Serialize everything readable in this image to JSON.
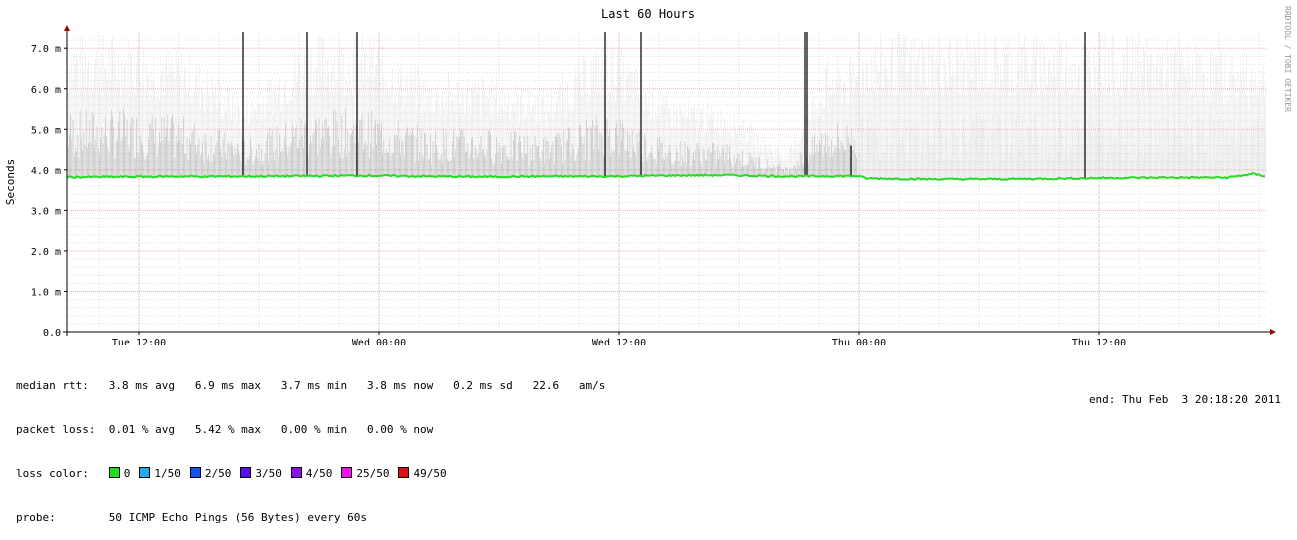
{
  "chart_data": {
    "type": "area",
    "title": "Last 60 Hours",
    "ylabel": "Seconds",
    "watermark": "RRDTOOL / TOBI OETIKER",
    "ylim": [
      0,
      7.4
    ],
    "y_ticks": [
      "0.0",
      "1.0 m",
      "2.0 m",
      "3.0 m",
      "4.0 m",
      "5.0 m",
      "6.0 m",
      "7.0 m"
    ],
    "y_tick_values": [
      0,
      1.0,
      2.0,
      3.0,
      4.0,
      5.0,
      6.0,
      7.0
    ],
    "x_range_hours": [
      0,
      60
    ],
    "x_ticks": [
      "Tue 12:00",
      "Wed 00:00",
      "Wed 12:00",
      "Thu 00:00",
      "Thu 12:00"
    ],
    "x_tick_hours": [
      3.6,
      15.6,
      27.6,
      39.6,
      51.6
    ],
    "grid": true,
    "series": [
      {
        "name": "median rtt",
        "unit": "ms",
        "color": "#22dd22",
        "x": [
          0,
          3,
          6,
          7.1,
          7.2,
          9,
          12,
          15,
          18,
          21,
          24,
          27,
          30,
          33,
          36,
          39.5,
          40,
          43,
          46,
          49,
          52,
          55,
          58,
          59.3,
          60
        ],
        "values": [
          3.82,
          3.83,
          3.84,
          3.83,
          3.84,
          3.84,
          3.85,
          3.86,
          3.84,
          3.83,
          3.84,
          3.84,
          3.86,
          3.87,
          3.84,
          3.85,
          3.79,
          3.77,
          3.77,
          3.78,
          3.8,
          3.81,
          3.81,
          3.9,
          3.84
        ]
      },
      {
        "name": "smoke spread",
        "unit": "ms",
        "color": "#000000",
        "x": [
          0,
          3,
          6,
          9,
          12,
          15,
          18,
          21,
          24,
          27,
          30,
          33,
          36,
          38,
          39.6,
          40,
          44,
          48,
          52,
          56,
          60
        ],
        "values": [
          7.4,
          7.4,
          7.0,
          5.8,
          7.4,
          7.4,
          6.4,
          6.4,
          6.0,
          7.4,
          5.8,
          5.6,
          4.4,
          6.8,
          6.8,
          7.4,
          7.4,
          7.4,
          7.4,
          7.2,
          6.8
        ]
      }
    ],
    "spikes_hours": [
      8.8,
      12.0,
      14.5,
      26.9,
      28.7,
      36.9,
      37.0,
      39.2,
      50.9
    ],
    "spikes_values": [
      7.4,
      7.4,
      7.4,
      7.4,
      7.4,
      7.4,
      7.4,
      4.6,
      7.4
    ]
  },
  "legend": {
    "median_rtt_label": "median rtt:",
    "median_rtt_values": "3.8 ms avg   6.9 ms max   3.7 ms min   3.8 ms now   0.2 ms sd   22.6   am/s",
    "packet_loss_label": "packet loss:",
    "packet_loss_values": "0.01 % avg   5.42 % max   0.00 % min   0.00 % now",
    "loss_color_label": "loss color:",
    "loss_colors": [
      {
        "label": "0",
        "color": "#22dd22"
      },
      {
        "label": "1/50",
        "color": "#22aaee"
      },
      {
        "label": "2/50",
        "color": "#1155ee"
      },
      {
        "label": "3/50",
        "color": "#5511ee"
      },
      {
        "label": "4/50",
        "color": "#8811ee"
      },
      {
        "label": "25/50",
        "color": "#ee11ee"
      },
      {
        "label": "49/50",
        "color": "#dd1111"
      }
    ],
    "probe_label": "probe:",
    "probe_value": "50 ICMP Echo Pings (56 Bytes) every 60s",
    "end_time": "end: Thu Feb  3 20:18:20 2011"
  }
}
